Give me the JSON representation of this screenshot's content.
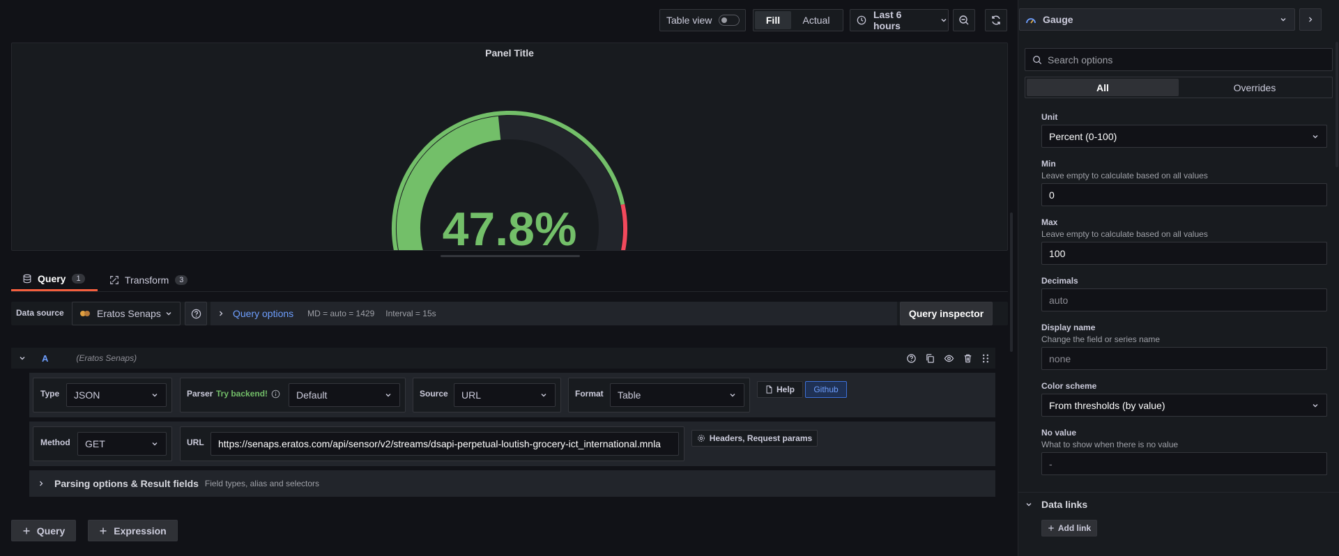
{
  "toolbar": {
    "table_view_label": "Table view",
    "fill_label": "Fill",
    "actual_label": "Actual",
    "time_range": "Last 6 hours"
  },
  "panel": {
    "title": "Panel Title",
    "gauge_value": 47.8,
    "gauge_text": "47.8%",
    "min": 0,
    "max": 100,
    "threshold_red_from": 80,
    "colors": {
      "green": "#73bf69",
      "red": "#f2495c",
      "track": "#22252b"
    }
  },
  "tabs": {
    "query_label": "Query",
    "query_count": "1",
    "transform_label": "Transform",
    "transform_count": "3"
  },
  "datasource": {
    "label": "Data source",
    "selected": "Eratos Senaps",
    "query_options_label": "Query options",
    "md_info": "MD = auto = 1429",
    "interval_info": "Interval = 15s",
    "inspector_label": "Query inspector"
  },
  "query": {
    "ref_id": "A",
    "ds_name": "(Eratos Senaps)",
    "type_label": "Type",
    "type_value": "JSON",
    "parser_label": "Parser",
    "parser_hint": "Try backend!",
    "parser_value": "Default",
    "source_label": "Source",
    "source_value": "URL",
    "format_label": "Format",
    "format_value": "Table",
    "help_label": "Help",
    "github_label": "Github",
    "method_label": "Method",
    "method_value": "GET",
    "url_label": "URL",
    "url_value": "https://senaps.eratos.com/api/sensor/v2/streams/dsapi-perpetual-loutish-grocery-ict_international.mnla",
    "headers_label": "Headers, Request params",
    "parsing_label": "Parsing options & Result fields",
    "parsing_desc": "Field types, alias and selectors"
  },
  "actions": {
    "add_query": "Query",
    "add_expression": "Expression"
  },
  "sidebar": {
    "viz_name": "Gauge",
    "search_placeholder": "Search options",
    "tab_all": "All",
    "tab_overrides": "Overrides",
    "unit_label": "Unit",
    "unit_value": "Percent (0-100)",
    "min_label": "Min",
    "min_desc": "Leave empty to calculate based on all values",
    "min_value": "0",
    "max_label": "Max",
    "max_desc": "Leave empty to calculate based on all values",
    "max_value": "100",
    "decimals_label": "Decimals",
    "decimals_placeholder": "auto",
    "display_name_label": "Display name",
    "display_name_desc": "Change the field or series name",
    "display_name_placeholder": "none",
    "color_scheme_label": "Color scheme",
    "color_scheme_value": "From thresholds (by value)",
    "no_value_label": "No value",
    "no_value_desc": "What to show when there is no value",
    "no_value_placeholder": "-",
    "data_links_label": "Data links",
    "add_link_label": "Add link"
  }
}
